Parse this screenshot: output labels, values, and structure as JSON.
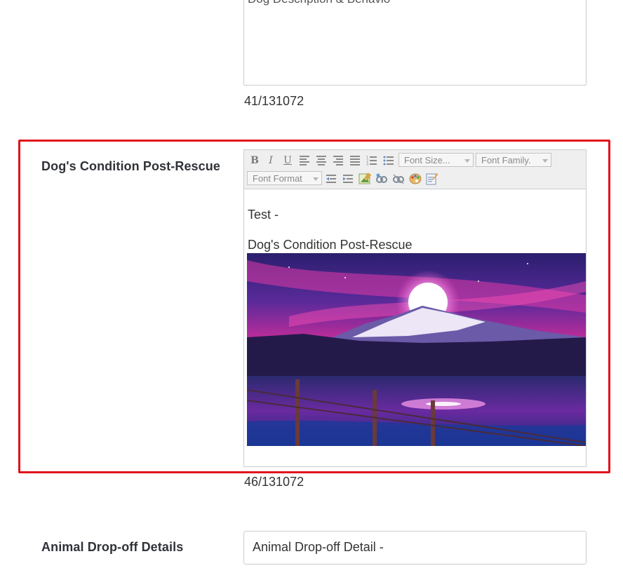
{
  "description_field": {
    "placeholder_visible": "Dog Description & Behavio",
    "char_count": "41/131072"
  },
  "condition_field": {
    "label": "Dog's Condition Post-Rescue",
    "toolbar": {
      "bold": "B",
      "italic": "I",
      "underline": "U",
      "font_size_label": "Font Size...",
      "font_family_label": "Font Family.",
      "font_format_label": "Font Format"
    },
    "content": {
      "line1": "Test -",
      "line2": "Dog's Condition Post-Rescue"
    },
    "char_count": "46/131072",
    "highlight_color": "#e0131c"
  },
  "dropoff_field": {
    "label": "Animal Drop-off Details",
    "value": "Animal Drop-off Detail -"
  }
}
